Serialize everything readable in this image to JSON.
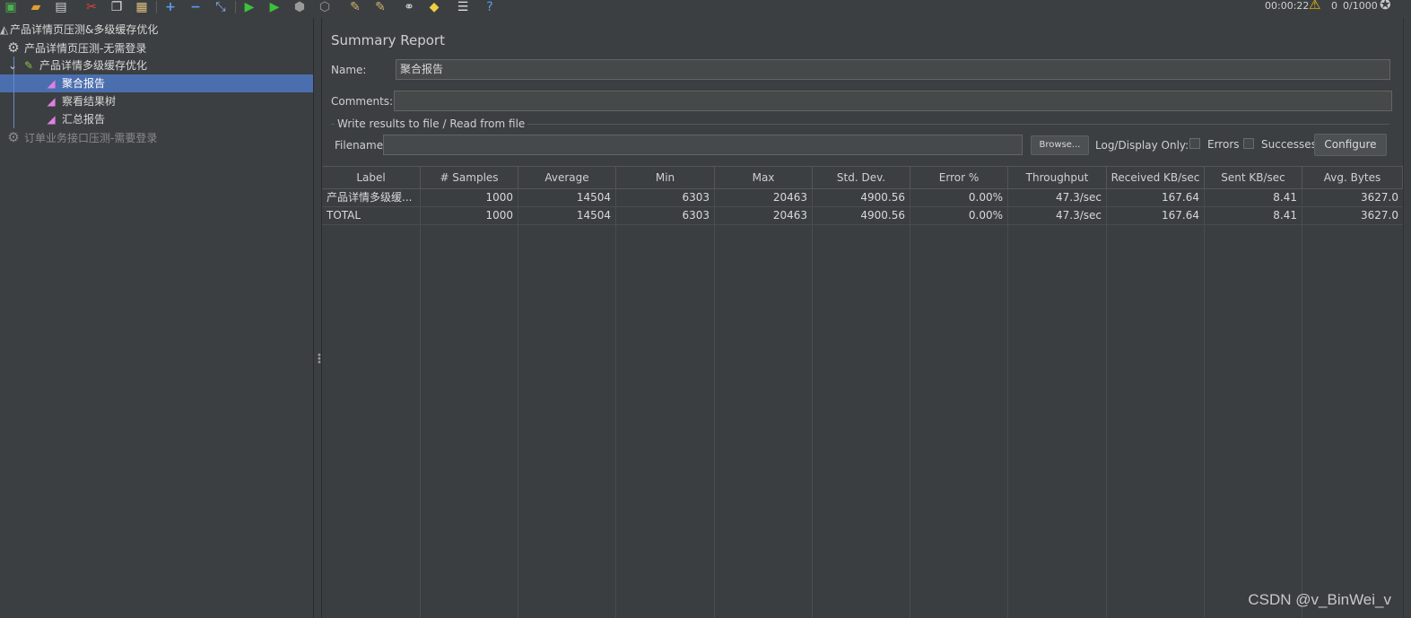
{
  "toolbar": {
    "timer": "00:00:22",
    "warning_count": "0",
    "threads": "0/1000"
  },
  "tree": {
    "root": "产品详情页压测&多级缓存优化",
    "group1": "产品详情页压测-无需登录",
    "sampler": "产品详情多级缓存优化",
    "items": [
      "聚合报告",
      "察看结果树",
      "汇总报告"
    ],
    "group2": "订单业务接口压测-需要登录"
  },
  "panel": {
    "title": "Summary Report",
    "name_label": "Name:",
    "name_value": "聚合报告",
    "comments_label": "Comments:",
    "comments_value": "",
    "group_title": "Write results to file / Read from file",
    "filename_label": "Filename",
    "filename_value": "",
    "browse_label": "Browse...",
    "log_display_label": "Log/Display Only:",
    "errors_label": "Errors",
    "successes_label": "Successes",
    "configure_label": "Configure"
  },
  "table": {
    "headers": [
      "Label",
      "# Samples",
      "Average",
      "Min",
      "Max",
      "Std. Dev.",
      "Error %",
      "Throughput",
      "Received KB/sec",
      "Sent KB/sec",
      "Avg. Bytes"
    ],
    "rows": [
      [
        "产品详情多级缓...",
        "1000",
        "14504",
        "6303",
        "20463",
        "4900.56",
        "0.00%",
        "47.3/sec",
        "167.64",
        "8.41",
        "3627.0"
      ],
      [
        "TOTAL",
        "1000",
        "14504",
        "6303",
        "20463",
        "4900.56",
        "0.00%",
        "47.3/sec",
        "167.64",
        "8.41",
        "3627.0"
      ]
    ]
  },
  "watermark": "CSDN @v_BinWei_v"
}
